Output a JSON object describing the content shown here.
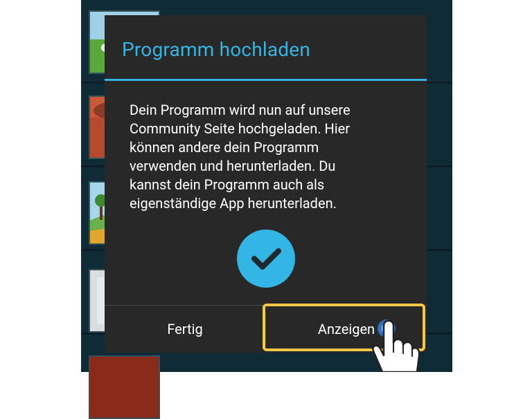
{
  "dialog": {
    "title": "Programm hochladen",
    "message_lines": [
      "Dein Programm wird nun auf unsere",
      "Community Seite hochgeladen. Hier",
      "können andere dein Programm",
      "verwenden und herunterladen. Du",
      "kannst dein Programm auch als",
      "eigenständige App herunterladen."
    ],
    "status_icon": "checkmark-circle-icon"
  },
  "buttons": {
    "done_label": "Fertig",
    "show_label": "Anzeigen"
  },
  "colors": {
    "accent": "#33b5e5",
    "highlight": "#f7c844",
    "dialog_bg": "#282828",
    "background": "#0f2b36"
  },
  "tutorial": {
    "pointer_icon": "hand-pointer-icon",
    "tap_indicator": "tap-indicator-icon"
  }
}
